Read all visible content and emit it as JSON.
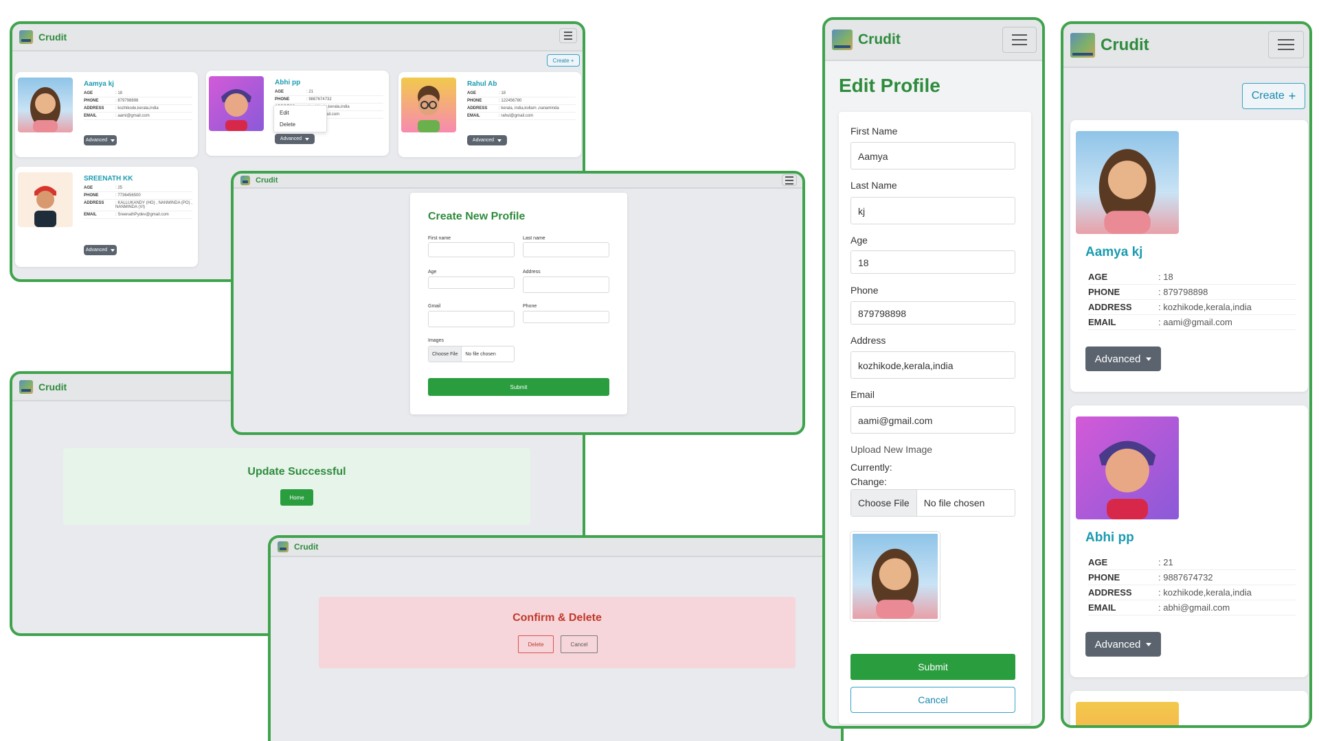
{
  "brand": "Crudit",
  "colors": {
    "frame": "#3fa34d",
    "brand": "#2e8b3c",
    "link": "#1a9bb0",
    "button_green": "#2a9d3f",
    "danger": "#c0392b"
  },
  "icons": {
    "menu": "hamburger-icon",
    "logo": "crud-logo-icon",
    "create": "plus-icon",
    "caret": "caret-down-icon"
  },
  "list_desktop": {
    "create_label": "Create +",
    "advanced_label": "Advanced",
    "dropdown": [
      "Edit",
      "Delete"
    ],
    "profiles": [
      {
        "name": "Aamya kj",
        "age": ": 18",
        "phone": ": 879798898",
        "address": ": kozhikode,kerala,india",
        "email": ": aami@gmail.com"
      },
      {
        "name": "Abhi pp",
        "age": ": 21",
        "phone": ": 9887674732",
        "address": ": kozhikode,kerala,india",
        "email": ": abhi@gmail.com"
      },
      {
        "name": "Rahul Ab",
        "age": ": 18",
        "phone": ": 122456780",
        "address": ": kerala, india,kollam ,nanaminda",
        "email": ": rahul@gmail.com"
      },
      {
        "name": "SREENATH KK",
        "age": ": 25",
        "phone": ": 7736456500",
        "address": ": KALLUKANDY (HO) , NANMINDA (PO) , NANMINDA (VI)",
        "email": ": SreenathPydev@gmail.com"
      }
    ],
    "labels": {
      "age": "AGE",
      "phone": "PHONE",
      "address": "ADDRESS",
      "email": "EMAIL"
    }
  },
  "create_form": {
    "title": "Create New Profile",
    "first_name": "First name",
    "last_name": "Last name",
    "age": "Age",
    "address": "Address",
    "gmail": "Gmail",
    "phone": "Phone",
    "images": "Images",
    "choose_file": "Choose File",
    "no_file": "No file chosen",
    "submit": "Submit"
  },
  "update_screen": {
    "title": "Update Successful",
    "home": "Home"
  },
  "delete_screen": {
    "title": "Confirm & Delete",
    "delete": "Delete",
    "cancel": "Cancel"
  },
  "edit_profile": {
    "title": "Edit Profile",
    "first_name_label": "First Name",
    "first_name": "Aamya",
    "last_name_label": "Last Name",
    "last_name": "kj",
    "age_label": "Age",
    "age": "18",
    "phone_label": "Phone",
    "phone": "879798898",
    "address_label": "Address",
    "address": "kozhikode,kerala,india",
    "email_label": "Email",
    "email": "aami@gmail.com",
    "upload_label": "Upload New Image",
    "currently": "Currently:",
    "change": "Change:",
    "choose_file": "Choose File",
    "no_file": "No file chosen",
    "submit": "Submit",
    "cancel": "Cancel"
  },
  "list_mobile": {
    "create_label": "Create",
    "advanced_label": "Advanced",
    "profiles": [
      {
        "name": "Aamya kj",
        "age": ": 18",
        "phone": ": 879798898",
        "address": ": kozhikode,kerala,india",
        "email": ": aami@gmail.com"
      },
      {
        "name": "Abhi pp",
        "age": ": 21",
        "phone": ": 9887674732",
        "address": ": kozhikode,kerala,india",
        "email": ": abhi@gmail.com"
      }
    ]
  }
}
